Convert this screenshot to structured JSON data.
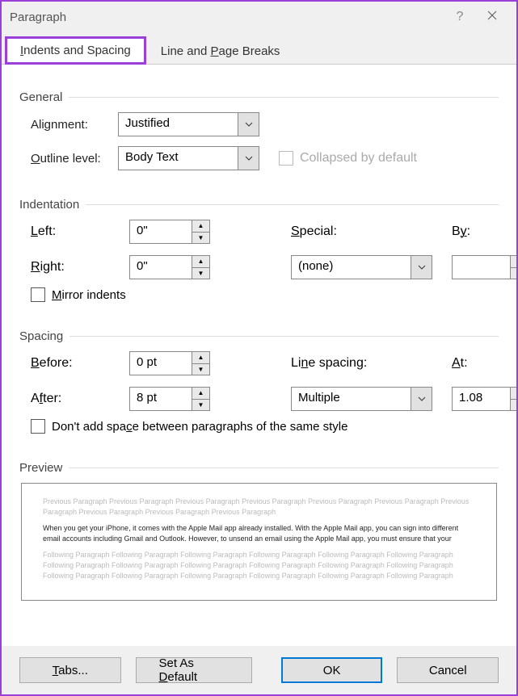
{
  "title": "Paragraph",
  "tabs": {
    "indents": "Indents and Spacing",
    "breaks": "Line and Page Breaks"
  },
  "general": {
    "header": "General",
    "alignment_label": "Alignment:",
    "alignment_value": "Justified",
    "outline_label": "Outline level:",
    "outline_value": "Body Text",
    "collapsed_label": "Collapsed by default"
  },
  "indentation": {
    "header": "Indentation",
    "left_label": "Left:",
    "left_value": "0\"",
    "right_label": "Right:",
    "right_value": "0\"",
    "special_label": "Special:",
    "special_value": "(none)",
    "by_label": "By:",
    "by_value": "",
    "mirror_label": "Mirror indents"
  },
  "spacing": {
    "header": "Spacing",
    "before_label": "Before:",
    "before_value": "0 pt",
    "after_label": "After:",
    "after_value": "8 pt",
    "line_label": "Line spacing:",
    "line_value": "Multiple",
    "at_label": "At:",
    "at_value": "1.08",
    "dont_add_label": "Don't add space between paragraphs of the same style"
  },
  "preview": {
    "header": "Preview",
    "prev": "Previous Paragraph Previous Paragraph Previous Paragraph Previous Paragraph Previous Paragraph Previous Paragraph Previous Paragraph Previous Paragraph Previous Paragraph Previous Paragraph",
    "sample": "When you get your iPhone, it comes with the Apple Mail app already installed. With the Apple Mail app, you can sign into different email accounts including Gmail and Outlook. However, to unsend an email using the Apple Mail app, you must ensure that your",
    "next": "Following Paragraph Following Paragraph Following Paragraph Following Paragraph Following Paragraph Following Paragraph Following Paragraph Following Paragraph Following Paragraph Following Paragraph Following Paragraph Following Paragraph Following Paragraph Following Paragraph Following Paragraph Following Paragraph Following Paragraph Following Paragraph"
  },
  "buttons": {
    "tabs": "Tabs...",
    "default": "Set As Default",
    "ok": "OK",
    "cancel": "Cancel"
  }
}
